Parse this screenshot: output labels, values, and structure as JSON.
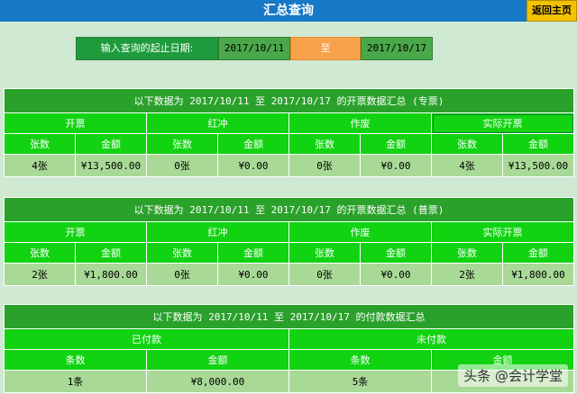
{
  "titlebar": {
    "title": "汇总查询",
    "home_label": "返回主页"
  },
  "datebar": {
    "label": "输入查询的起止日期:",
    "start": "2017/10/11",
    "to": "至",
    "end": "2017/10/17"
  },
  "section1": {
    "heading": "以下数据为 2017/10/11 至 2017/10/17 的开票数据汇总 (专票)",
    "groups": [
      "开票",
      "红冲",
      "作废",
      "实际开票"
    ],
    "sub": [
      "张数",
      "金额",
      "张数",
      "金额",
      "张数",
      "金额",
      "张数",
      "金额"
    ],
    "values": [
      "4张",
      "¥13,500.00",
      "0张",
      "¥0.00",
      "0张",
      "¥0.00",
      "4张",
      "¥13,500.00"
    ]
  },
  "section2": {
    "heading": "以下数据为 2017/10/11 至 2017/10/17 的开票数据汇总 (普票)",
    "groups": [
      "开票",
      "红冲",
      "作废",
      "实际开票"
    ],
    "sub": [
      "张数",
      "金额",
      "张数",
      "金额",
      "张数",
      "金额",
      "张数",
      "金额"
    ],
    "values": [
      "2张",
      "¥1,800.00",
      "0张",
      "¥0.00",
      "0张",
      "¥0.00",
      "2张",
      "¥1,800.00"
    ]
  },
  "section3": {
    "heading": "以下数据为 2017/10/11 至 2017/10/17 的付款数据汇总",
    "groups": [
      "已付款",
      "未付款"
    ],
    "sub": [
      "条数",
      "金额",
      "条数",
      "金额"
    ],
    "values": [
      "1条",
      "¥8,000.00",
      "5条",
      ""
    ]
  },
  "watermark": "头条 @会计学堂"
}
